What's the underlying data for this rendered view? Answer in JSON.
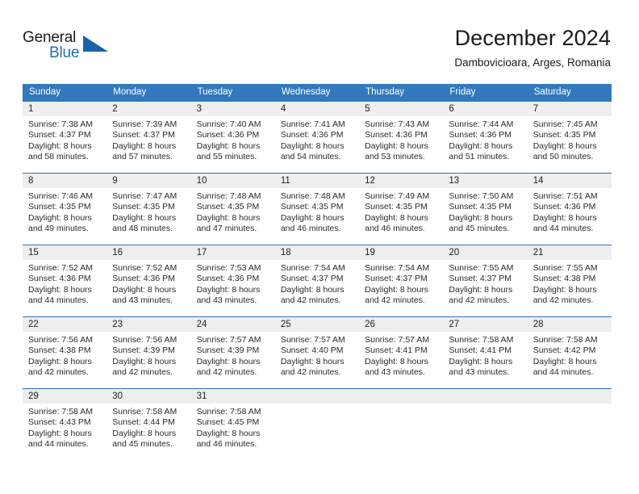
{
  "brand": {
    "name_part1": "General",
    "name_part2": "Blue",
    "triangle_color": "#1565a8",
    "blue_color": "#1d6fb8"
  },
  "header": {
    "title": "December 2024",
    "subtitle": "Dambovicioara, Arges, Romania"
  },
  "theme": {
    "header_bg": "#3279bd",
    "row_divider": "#2f72b5",
    "daynum_bg": "#eeeeee"
  },
  "weekdays": [
    "Sunday",
    "Monday",
    "Tuesday",
    "Wednesday",
    "Thursday",
    "Friday",
    "Saturday"
  ],
  "weeks": [
    [
      {
        "day": "1",
        "sunrise": "Sunrise: 7:38 AM",
        "sunset": "Sunset: 4:37 PM",
        "daylight1": "Daylight: 8 hours",
        "daylight2": "and 58 minutes."
      },
      {
        "day": "2",
        "sunrise": "Sunrise: 7:39 AM",
        "sunset": "Sunset: 4:37 PM",
        "daylight1": "Daylight: 8 hours",
        "daylight2": "and 57 minutes."
      },
      {
        "day": "3",
        "sunrise": "Sunrise: 7:40 AM",
        "sunset": "Sunset: 4:36 PM",
        "daylight1": "Daylight: 8 hours",
        "daylight2": "and 55 minutes."
      },
      {
        "day": "4",
        "sunrise": "Sunrise: 7:41 AM",
        "sunset": "Sunset: 4:36 PM",
        "daylight1": "Daylight: 8 hours",
        "daylight2": "and 54 minutes."
      },
      {
        "day": "5",
        "sunrise": "Sunrise: 7:43 AM",
        "sunset": "Sunset: 4:36 PM",
        "daylight1": "Daylight: 8 hours",
        "daylight2": "and 53 minutes."
      },
      {
        "day": "6",
        "sunrise": "Sunrise: 7:44 AM",
        "sunset": "Sunset: 4:36 PM",
        "daylight1": "Daylight: 8 hours",
        "daylight2": "and 51 minutes."
      },
      {
        "day": "7",
        "sunrise": "Sunrise: 7:45 AM",
        "sunset": "Sunset: 4:35 PM",
        "daylight1": "Daylight: 8 hours",
        "daylight2": "and 50 minutes."
      }
    ],
    [
      {
        "day": "8",
        "sunrise": "Sunrise: 7:46 AM",
        "sunset": "Sunset: 4:35 PM",
        "daylight1": "Daylight: 8 hours",
        "daylight2": "and 49 minutes."
      },
      {
        "day": "9",
        "sunrise": "Sunrise: 7:47 AM",
        "sunset": "Sunset: 4:35 PM",
        "daylight1": "Daylight: 8 hours",
        "daylight2": "and 48 minutes."
      },
      {
        "day": "10",
        "sunrise": "Sunrise: 7:48 AM",
        "sunset": "Sunset: 4:35 PM",
        "daylight1": "Daylight: 8 hours",
        "daylight2": "and 47 minutes."
      },
      {
        "day": "11",
        "sunrise": "Sunrise: 7:48 AM",
        "sunset": "Sunset: 4:35 PM",
        "daylight1": "Daylight: 8 hours",
        "daylight2": "and 46 minutes."
      },
      {
        "day": "12",
        "sunrise": "Sunrise: 7:49 AM",
        "sunset": "Sunset: 4:35 PM",
        "daylight1": "Daylight: 8 hours",
        "daylight2": "and 46 minutes."
      },
      {
        "day": "13",
        "sunrise": "Sunrise: 7:50 AM",
        "sunset": "Sunset: 4:35 PM",
        "daylight1": "Daylight: 8 hours",
        "daylight2": "and 45 minutes."
      },
      {
        "day": "14",
        "sunrise": "Sunrise: 7:51 AM",
        "sunset": "Sunset: 4:36 PM",
        "daylight1": "Daylight: 8 hours",
        "daylight2": "and 44 minutes."
      }
    ],
    [
      {
        "day": "15",
        "sunrise": "Sunrise: 7:52 AM",
        "sunset": "Sunset: 4:36 PM",
        "daylight1": "Daylight: 8 hours",
        "daylight2": "and 44 minutes."
      },
      {
        "day": "16",
        "sunrise": "Sunrise: 7:52 AM",
        "sunset": "Sunset: 4:36 PM",
        "daylight1": "Daylight: 8 hours",
        "daylight2": "and 43 minutes."
      },
      {
        "day": "17",
        "sunrise": "Sunrise: 7:53 AM",
        "sunset": "Sunset: 4:36 PM",
        "daylight1": "Daylight: 8 hours",
        "daylight2": "and 43 minutes."
      },
      {
        "day": "18",
        "sunrise": "Sunrise: 7:54 AM",
        "sunset": "Sunset: 4:37 PM",
        "daylight1": "Daylight: 8 hours",
        "daylight2": "and 42 minutes."
      },
      {
        "day": "19",
        "sunrise": "Sunrise: 7:54 AM",
        "sunset": "Sunset: 4:37 PM",
        "daylight1": "Daylight: 8 hours",
        "daylight2": "and 42 minutes."
      },
      {
        "day": "20",
        "sunrise": "Sunrise: 7:55 AM",
        "sunset": "Sunset: 4:37 PM",
        "daylight1": "Daylight: 8 hours",
        "daylight2": "and 42 minutes."
      },
      {
        "day": "21",
        "sunrise": "Sunrise: 7:55 AM",
        "sunset": "Sunset: 4:38 PM",
        "daylight1": "Daylight: 8 hours",
        "daylight2": "and 42 minutes."
      }
    ],
    [
      {
        "day": "22",
        "sunrise": "Sunrise: 7:56 AM",
        "sunset": "Sunset: 4:38 PM",
        "daylight1": "Daylight: 8 hours",
        "daylight2": "and 42 minutes."
      },
      {
        "day": "23",
        "sunrise": "Sunrise: 7:56 AM",
        "sunset": "Sunset: 4:39 PM",
        "daylight1": "Daylight: 8 hours",
        "daylight2": "and 42 minutes."
      },
      {
        "day": "24",
        "sunrise": "Sunrise: 7:57 AM",
        "sunset": "Sunset: 4:39 PM",
        "daylight1": "Daylight: 8 hours",
        "daylight2": "and 42 minutes."
      },
      {
        "day": "25",
        "sunrise": "Sunrise: 7:57 AM",
        "sunset": "Sunset: 4:40 PM",
        "daylight1": "Daylight: 8 hours",
        "daylight2": "and 42 minutes."
      },
      {
        "day": "26",
        "sunrise": "Sunrise: 7:57 AM",
        "sunset": "Sunset: 4:41 PM",
        "daylight1": "Daylight: 8 hours",
        "daylight2": "and 43 minutes."
      },
      {
        "day": "27",
        "sunrise": "Sunrise: 7:58 AM",
        "sunset": "Sunset: 4:41 PM",
        "daylight1": "Daylight: 8 hours",
        "daylight2": "and 43 minutes."
      },
      {
        "day": "28",
        "sunrise": "Sunrise: 7:58 AM",
        "sunset": "Sunset: 4:42 PM",
        "daylight1": "Daylight: 8 hours",
        "daylight2": "and 44 minutes."
      }
    ],
    [
      {
        "day": "29",
        "sunrise": "Sunrise: 7:58 AM",
        "sunset": "Sunset: 4:43 PM",
        "daylight1": "Daylight: 8 hours",
        "daylight2": "and 44 minutes."
      },
      {
        "day": "30",
        "sunrise": "Sunrise: 7:58 AM",
        "sunset": "Sunset: 4:44 PM",
        "daylight1": "Daylight: 8 hours",
        "daylight2": "and 45 minutes."
      },
      {
        "day": "31",
        "sunrise": "Sunrise: 7:58 AM",
        "sunset": "Sunset: 4:45 PM",
        "daylight1": "Daylight: 8 hours",
        "daylight2": "and 46 minutes."
      },
      {
        "day": "",
        "sunrise": "",
        "sunset": "",
        "daylight1": "",
        "daylight2": ""
      },
      {
        "day": "",
        "sunrise": "",
        "sunset": "",
        "daylight1": "",
        "daylight2": ""
      },
      {
        "day": "",
        "sunrise": "",
        "sunset": "",
        "daylight1": "",
        "daylight2": ""
      },
      {
        "day": "",
        "sunrise": "",
        "sunset": "",
        "daylight1": "",
        "daylight2": ""
      }
    ]
  ]
}
